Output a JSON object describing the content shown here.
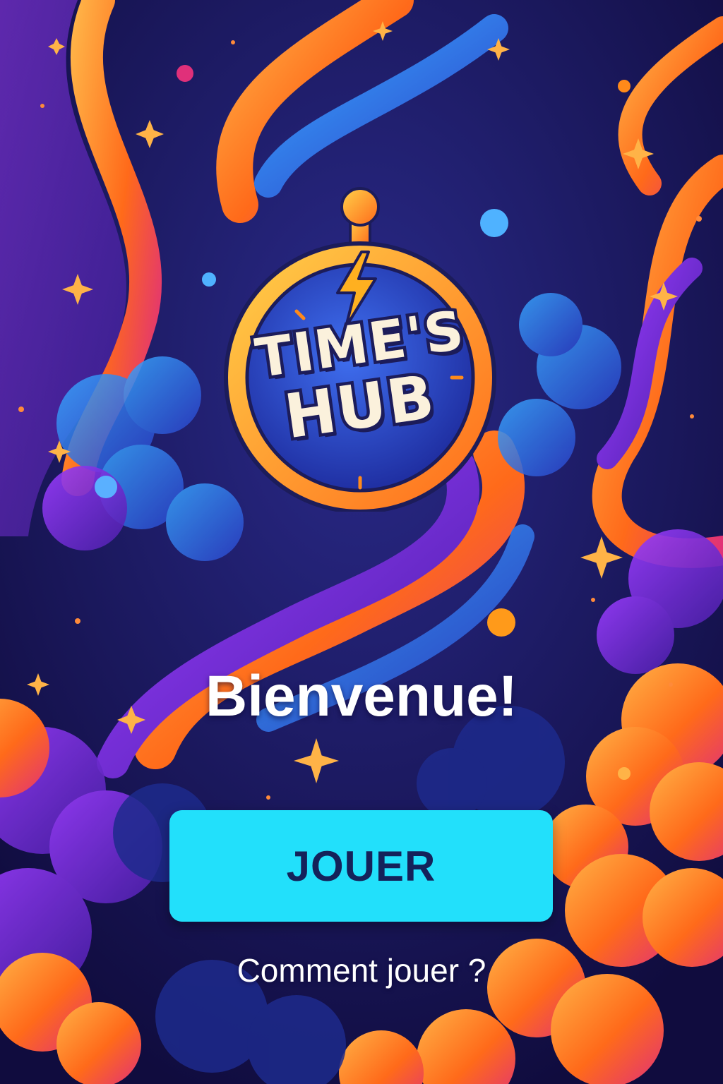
{
  "logo": {
    "line1": "TIME'S",
    "line2": "HUB"
  },
  "welcome_title": "Bienvenue!",
  "play_button": {
    "label": "JOUER"
  },
  "how_to_link": {
    "label": "Comment jouer ?"
  },
  "icons": [
    "stopwatch-icon",
    "lightning-icon",
    "sparkle-icon"
  ],
  "colors": {
    "background": "#14104a",
    "accent_orange": "#ff7a1a",
    "accent_purple": "#7b2fd0",
    "accent_blue": "#2a5be0",
    "button": "#22e0fb",
    "button_text": "#14225a",
    "text": "#ffffff"
  }
}
